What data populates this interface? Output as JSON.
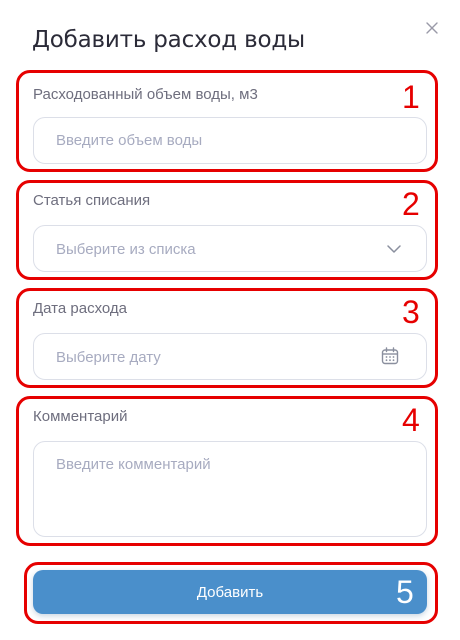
{
  "modal": {
    "title": "Добавить расход воды"
  },
  "fields": {
    "volume": {
      "label": "Расходованный объем воды, м3",
      "placeholder": "Введите объем воды",
      "annotation": "1"
    },
    "writeoff": {
      "label": "Статья списания",
      "placeholder": "Выберите из списка",
      "annotation": "2"
    },
    "date": {
      "label": "Дата расхода",
      "placeholder": "Выберите дату",
      "annotation": "3"
    },
    "comment": {
      "label": "Комментарий",
      "placeholder": "Введите комментарий",
      "annotation": "4"
    }
  },
  "submit": {
    "label": "Добавить",
    "annotation": "5"
  },
  "colors": {
    "accent": "#4a8fcb",
    "annotation": "#e60000",
    "placeholder": "#a7abc0",
    "border": "#dcdfe8"
  },
  "icons": {
    "close": "close-icon",
    "dropdown": "chevron-down-icon",
    "calendar": "calendar-icon"
  }
}
